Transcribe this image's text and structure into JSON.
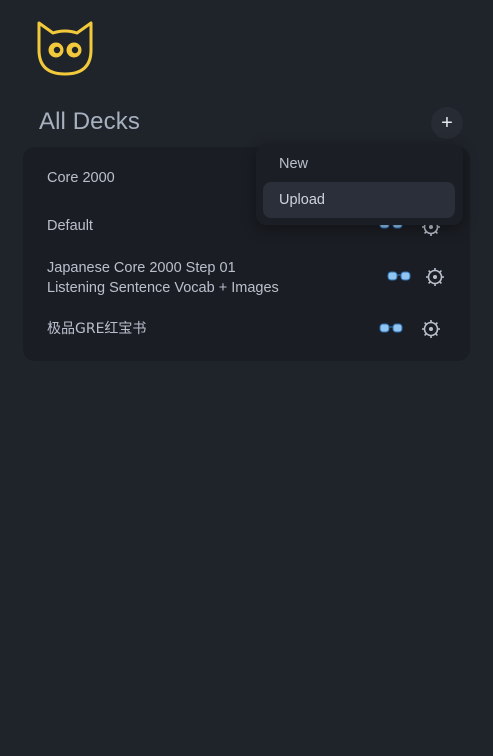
{
  "header": {
    "title": "All Decks",
    "add_label": "+"
  },
  "decks": [
    {
      "name": "Core 2000"
    },
    {
      "name": "Default"
    },
    {
      "name": "Japanese Core 2000 Step 01",
      "name_line2": "Listening Sentence Vocab + Images"
    },
    {
      "name": "极品GRE红宝书"
    }
  ],
  "menu": {
    "items": [
      {
        "label": "New"
      },
      {
        "label": "Upload",
        "hovered": true
      }
    ]
  },
  "colors": {
    "background": "#1f232a",
    "panel": "#1a1d23",
    "text": "#b9c0cc",
    "title": "#a7b0bf",
    "logo": "#f1c93b",
    "menu_hover": "#2a2f39"
  },
  "icons": {
    "logo": "cat-logo-icon",
    "study": "glasses-icon",
    "settings": "gear-icon",
    "add": "plus-icon"
  }
}
